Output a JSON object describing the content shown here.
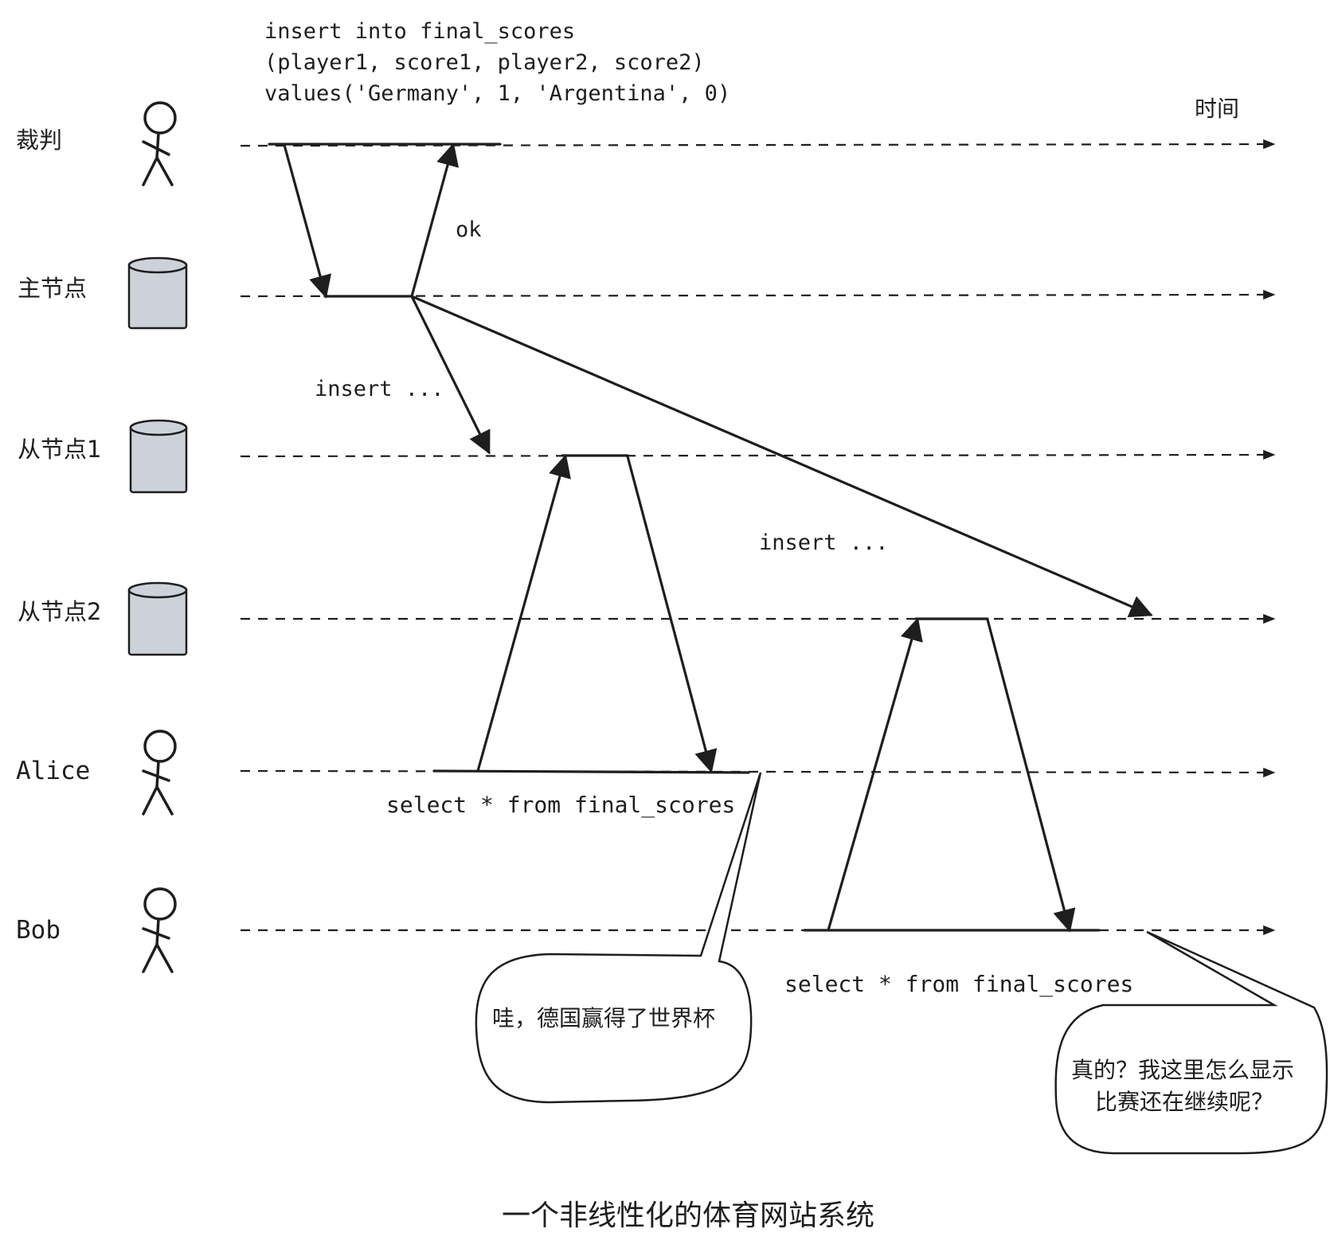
{
  "axis_label": "时间",
  "sql_lines": [
    "insert into final_scores",
    "(player1, score1, player2, score2)",
    "values('Germany', 1, 'Argentina', 0)"
  ],
  "lanes": [
    {
      "label": "裁判",
      "icon": "person-icon"
    },
    {
      "label": "主节点",
      "icon": "database-icon"
    },
    {
      "label": "从节点1",
      "icon": "database-icon"
    },
    {
      "label": "从节点2",
      "icon": "database-icon"
    },
    {
      "label": "Alice",
      "icon": "person-icon"
    },
    {
      "label": "Bob",
      "icon": "person-icon"
    }
  ],
  "messages": {
    "ok": "ok",
    "insert_slave1": "insert ...",
    "insert_slave2": "insert ...",
    "alice_query": "select * from final_scores",
    "bob_query": "select * from final_scores"
  },
  "bubbles": {
    "alice": "哇，德国赢得了世界杯",
    "bob_line1": "真的？我这里怎么显示",
    "bob_line2": "比赛还在继续呢？"
  },
  "caption": "一个非线性化的体育网站系统"
}
